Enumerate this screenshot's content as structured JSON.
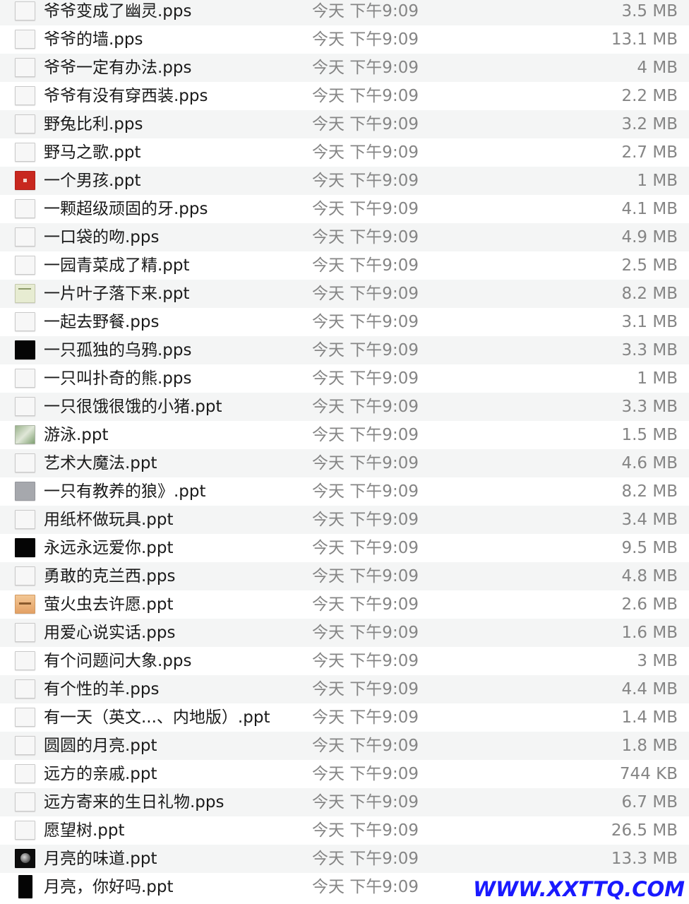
{
  "files": [
    {
      "name": "爷爷变成了幽灵.pps",
      "date": "今天 下午9:09",
      "size": "3.5 MB",
      "thumb": "blank"
    },
    {
      "name": "爷爷的墙.pps",
      "date": "今天 下午9:09",
      "size": "13.1 MB",
      "thumb": "blank"
    },
    {
      "name": "爷爷一定有办法.pps",
      "date": "今天 下午9:09",
      "size": "4 MB",
      "thumb": "blank"
    },
    {
      "name": "爷爷有没有穿西装.pps",
      "date": "今天 下午9:09",
      "size": "2.2 MB",
      "thumb": "blank"
    },
    {
      "name": "野兔比利.pps",
      "date": "今天 下午9:09",
      "size": "3.2 MB",
      "thumb": "blank"
    },
    {
      "name": "野马之歌.ppt",
      "date": "今天 下午9:09",
      "size": "2.7 MB",
      "thumb": "blank"
    },
    {
      "name": "一个男孩.ppt",
      "date": "今天 下午9:09",
      "size": "1 MB",
      "thumb": "red"
    },
    {
      "name": "一颗超级顽固的牙.pps",
      "date": "今天 下午9:09",
      "size": "4.1 MB",
      "thumb": "blank"
    },
    {
      "name": "一口袋的吻.pps",
      "date": "今天 下午9:09",
      "size": "4.9 MB",
      "thumb": "blank"
    },
    {
      "name": "一园青菜成了精.ppt",
      "date": "今天 下午9:09",
      "size": "2.5 MB",
      "thumb": "blank"
    },
    {
      "name": "一片叶子落下来.ppt",
      "date": "今天 下午9:09",
      "size": "8.2 MB",
      "thumb": "green"
    },
    {
      "name": "一起去野餐.pps",
      "date": "今天 下午9:09",
      "size": "3.1 MB",
      "thumb": "blank"
    },
    {
      "name": "一只孤独的乌鸦.pps",
      "date": "今天 下午9:09",
      "size": "3.3 MB",
      "thumb": "black"
    },
    {
      "name": "一只叫扑奇的熊.pps",
      "date": "今天 下午9:09",
      "size": "1 MB",
      "thumb": "blank"
    },
    {
      "name": "一只很饿很饿的小猪.ppt",
      "date": "今天 下午9:09",
      "size": "3.3 MB",
      "thumb": "blank"
    },
    {
      "name": "游泳.ppt",
      "date": "今天 下午9:09",
      "size": "1.5 MB",
      "thumb": "nature"
    },
    {
      "name": "艺术大魔法.ppt",
      "date": "今天 下午9:09",
      "size": "4.6 MB",
      "thumb": "blank"
    },
    {
      "name": "一只有教养的狼》.ppt",
      "date": "今天 下午9:09",
      "size": "8.2 MB",
      "thumb": "grey"
    },
    {
      "name": "用纸杯做玩具.ppt",
      "date": "今天 下午9:09",
      "size": "3.4 MB",
      "thumb": "blank"
    },
    {
      "name": "永远永远爱你.ppt",
      "date": "今天 下午9:09",
      "size": "9.5 MB",
      "thumb": "black"
    },
    {
      "name": "勇敢的克兰西.pps",
      "date": "今天 下午9:09",
      "size": "4.8 MB",
      "thumb": "blank"
    },
    {
      "name": "萤火虫去许愿.ppt",
      "date": "今天 下午9:09",
      "size": "2.6 MB",
      "thumb": "orange"
    },
    {
      "name": "用爱心说实话.pps",
      "date": "今天 下午9:09",
      "size": "1.6 MB",
      "thumb": "blank"
    },
    {
      "name": "有个问题问大象.pps",
      "date": "今天 下午9:09",
      "size": "3 MB",
      "thumb": "blank"
    },
    {
      "name": "有个性的羊.pps",
      "date": "今天 下午9:09",
      "size": "4.4 MB",
      "thumb": "blank"
    },
    {
      "name": "有一天（英文...、内地版）.ppt",
      "date": "今天 下午9:09",
      "size": "1.4 MB",
      "thumb": "blank"
    },
    {
      "name": "圆圆的月亮.ppt",
      "date": "今天 下午9:09",
      "size": "1.8 MB",
      "thumb": "blank"
    },
    {
      "name": "远方的亲戚.ppt",
      "date": "今天 下午9:09",
      "size": "744 KB",
      "thumb": "blank"
    },
    {
      "name": "远方寄来的生日礼物.pps",
      "date": "今天 下午9:09",
      "size": "6.7 MB",
      "thumb": "blank"
    },
    {
      "name": "愿望树.ppt",
      "date": "今天 下午9:09",
      "size": "26.5 MB",
      "thumb": "blank"
    },
    {
      "name": "月亮的味道.ppt",
      "date": "今天 下午9:09",
      "size": "13.3 MB",
      "thumb": "moon"
    },
    {
      "name": "月亮，你好吗.ppt",
      "date": "今天 下午9:09",
      "size": "",
      "thumb": "portrait"
    }
  ],
  "watermark": "WWW.XXTTQ.COM"
}
